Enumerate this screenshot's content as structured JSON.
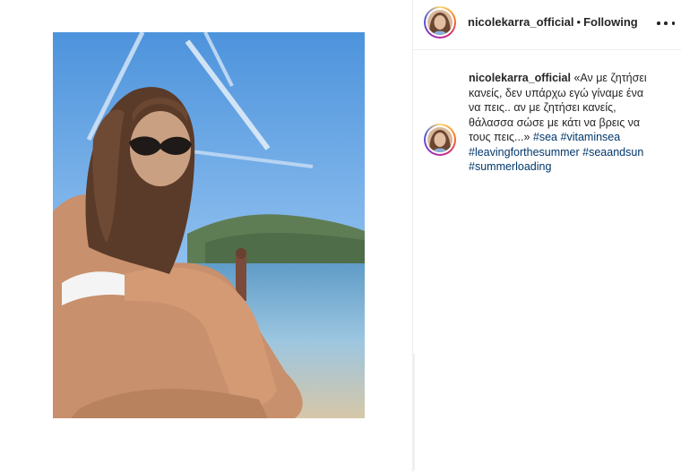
{
  "header": {
    "username": "nicolekarra_official",
    "dot": "•",
    "follow_status": "Following"
  },
  "caption": {
    "username": "nicolekarra_official",
    "text": "«Αν με ζητήσει κανείς, δεν υπάρχω εγώ γίναμε ένα να πεις.. αν με ζητήσει κανείς, θάλασσα σώσε με κάτι να βρεις να τους πεις...»",
    "hashtags": [
      "#sea",
      "#vitaminsea",
      "#leavingforthesummer",
      "#seaandsun",
      "#summerloading"
    ]
  },
  "icons": {
    "more": "more-options-icon",
    "avatar": "profile-avatar"
  },
  "colors": {
    "text": "#262626",
    "hashtag": "#00376b",
    "border": "#efefef",
    "sky": "#5c9fe0",
    "sea": "#7fb4d6"
  }
}
